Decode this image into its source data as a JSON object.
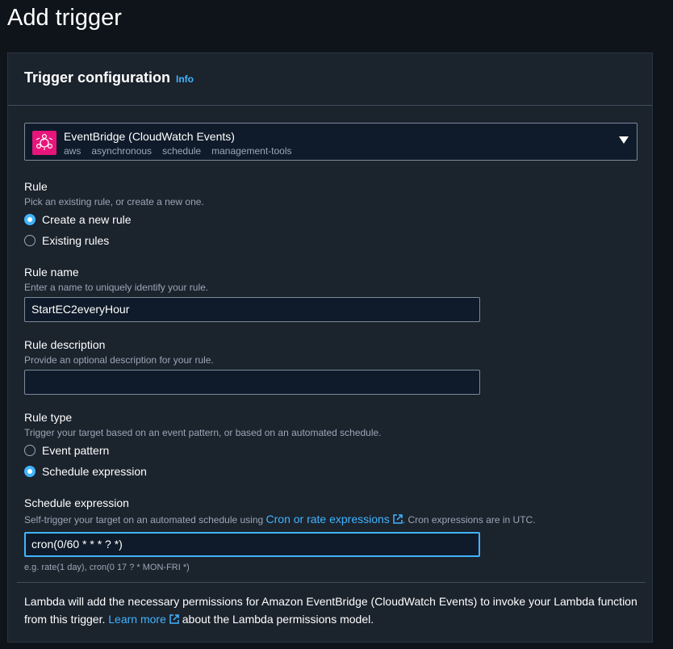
{
  "page": {
    "title": "Add trigger"
  },
  "panel": {
    "title": "Trigger configuration",
    "info_label": "Info"
  },
  "trigger_select": {
    "title": "EventBridge (CloudWatch Events)",
    "tags": [
      "aws",
      "asynchronous",
      "schedule",
      "management-tools"
    ],
    "icon": "eventbridge-icon",
    "icon_color": "#e7157b"
  },
  "rule": {
    "label": "Rule",
    "description": "Pick an existing rule, or create a new one.",
    "options": [
      {
        "label": "Create a new rule",
        "checked": true
      },
      {
        "label": "Existing rules",
        "checked": false
      }
    ]
  },
  "rule_name": {
    "label": "Rule name",
    "description": "Enter a name to uniquely identify your rule.",
    "value": "StartEC2everyHour"
  },
  "rule_description": {
    "label": "Rule description",
    "description": "Provide an optional description for your rule.",
    "value": ""
  },
  "rule_type": {
    "label": "Rule type",
    "description": "Trigger your target based on an event pattern, or based on an automated schedule.",
    "options": [
      {
        "label": "Event pattern",
        "checked": false
      },
      {
        "label": "Schedule expression",
        "checked": true
      }
    ]
  },
  "schedule_expression": {
    "label": "Schedule expression",
    "description_before": "Self-trigger your target on an automated schedule using ",
    "link_label": "Cron or rate expressions",
    "description_after": ". Cron expressions are in UTC.",
    "value": "cron(0/60 * * * ? *)",
    "hint": "e.g. rate(1 day), cron(0 17 ? * MON-FRI *)"
  },
  "footer": {
    "text_before": "Lambda will add the necessary permissions for Amazon EventBridge (CloudWatch Events) to invoke your Lambda function from this trigger. ",
    "link_label": "Learn more",
    "text_after": " about the Lambda permissions model."
  },
  "colors": {
    "accent": "#42b4ff",
    "panel_bg": "#1b232d",
    "input_bg": "#0f1b2a"
  }
}
